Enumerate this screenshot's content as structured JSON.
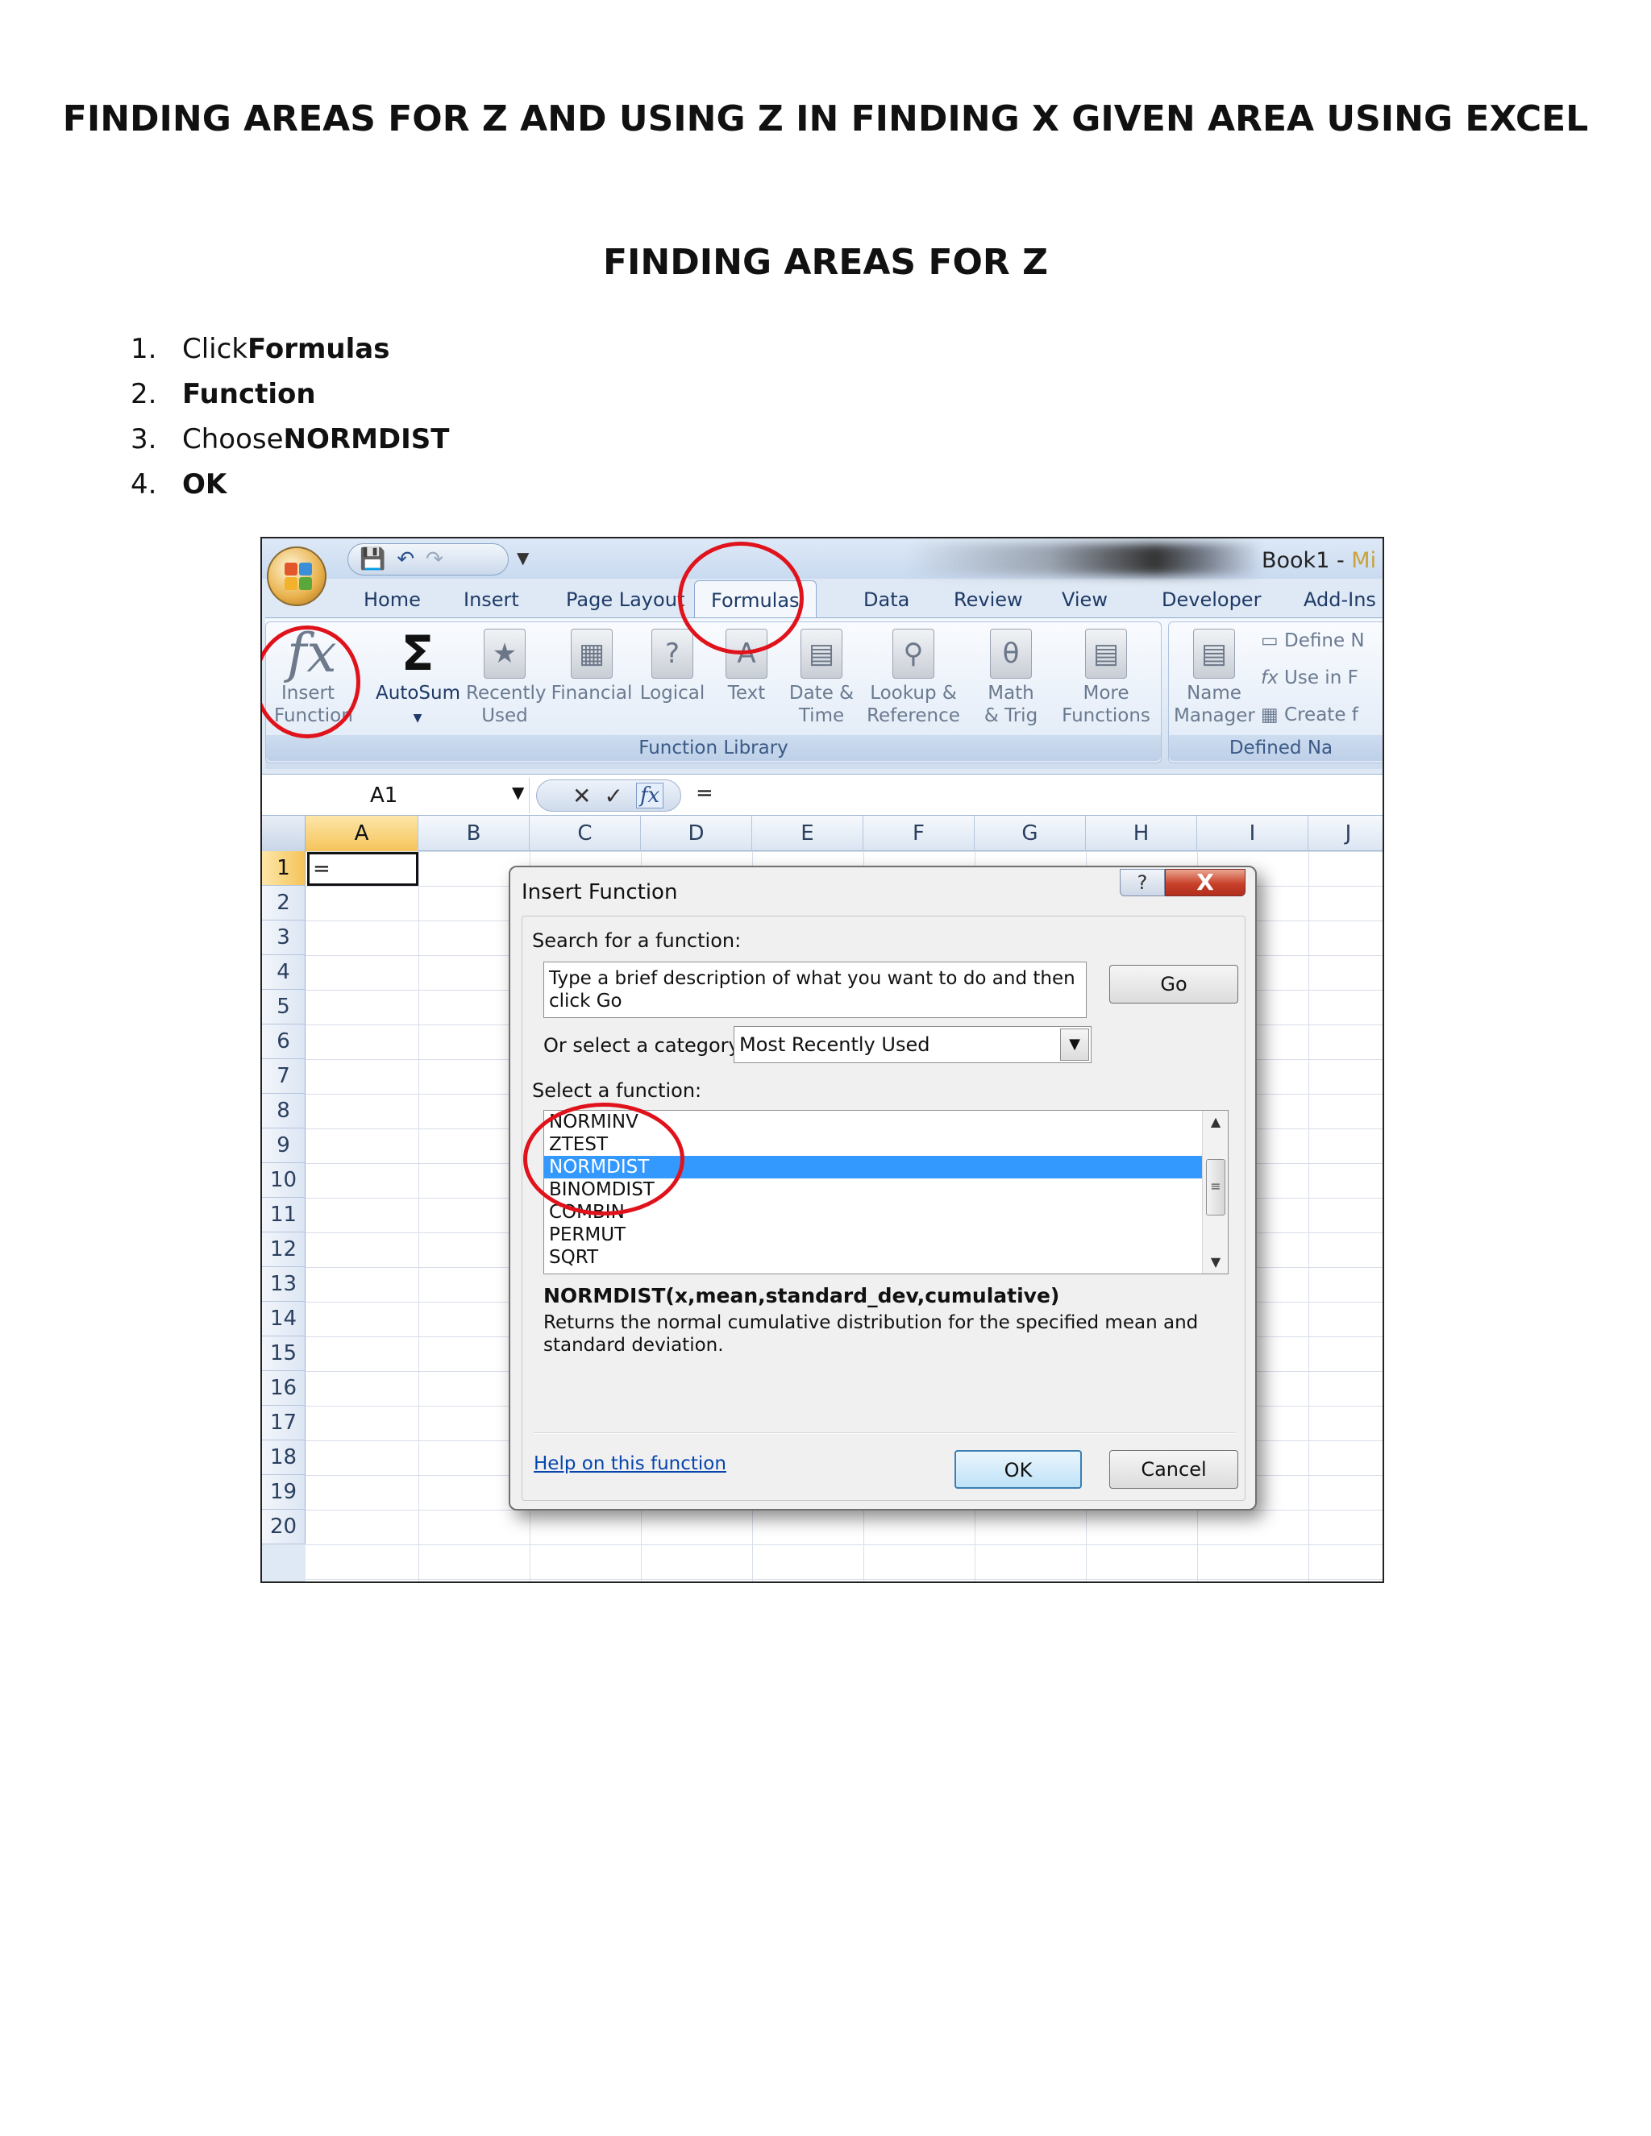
{
  "document": {
    "title": "FINDING AREAS FOR Z AND USING Z IN FINDING X GIVEN AREA USING EXCEL",
    "section_title": "FINDING AREAS FOR Z",
    "steps": [
      {
        "num": "1.",
        "prefix": "Click ",
        "bold": "Formulas"
      },
      {
        "num": "2.",
        "prefix": "",
        "bold": "Function"
      },
      {
        "num": "3.",
        "prefix": "Choose ",
        "bold": "NORMDIST"
      },
      {
        "num": "4.",
        "prefix": "",
        "bold": "OK"
      }
    ]
  },
  "excel": {
    "window_title": "Book1 - ",
    "window_title_suffix": "Mi",
    "tabs": [
      "Home",
      "Insert",
      "Page Layout",
      "Formulas",
      "Data",
      "Review",
      "View",
      "Developer",
      "Add-Ins"
    ],
    "active_tab": "Formulas",
    "ribbon": {
      "insert_function": {
        "line1": "Insert",
        "line2": "Function"
      },
      "autosum": "AutoSum",
      "recently_used": {
        "line1": "Recently",
        "line2": "Used"
      },
      "financial": "Financial",
      "logical": "Logical",
      "text": "Text",
      "date_time": {
        "line1": "Date &",
        "line2": "Time"
      },
      "lookup_reference": {
        "line1": "Lookup &",
        "line2": "Reference"
      },
      "math_trig": {
        "line1": "Math",
        "line2": "& Trig"
      },
      "more_functions": {
        "line1": "More",
        "line2": "Functions"
      },
      "function_library_label": "Function Library",
      "name_manager": {
        "line1": "Name",
        "line2": "Manager"
      },
      "define_name": "Define N",
      "use_in_formula": "Use in F",
      "create_from_selection": "Create f",
      "defined_names_label": "Defined Na"
    },
    "name_box": "A1",
    "formula_bar_content": "=",
    "columns": [
      "A",
      "B",
      "C",
      "D",
      "E",
      "F",
      "G",
      "H",
      "I",
      "J"
    ],
    "rows": [
      "1",
      "2",
      "3",
      "4",
      "5",
      "6",
      "7",
      "8",
      "9",
      "10",
      "11",
      "12",
      "13",
      "14",
      "15",
      "16",
      "17",
      "18",
      "19",
      "20"
    ],
    "cell_a1": "="
  },
  "dialog": {
    "title": "Insert Function",
    "help_glyph": "?",
    "close_glyph": "X",
    "search_label": "Search for a function:",
    "search_text": "Type a brief description of what you want to do and then click Go",
    "go_button": "Go",
    "category_label": "Or select a category:",
    "category_value": "Most Recently Used",
    "select_label": "Select a function:",
    "functions": [
      "NORMINV",
      "ZTEST",
      "NORMDIST",
      "BINOMDIST",
      "COMBIN",
      "PERMUT",
      "SQRT"
    ],
    "selected_function": "NORMDIST",
    "syntax": "NORMDIST(x,mean,standard_dev,cumulative)",
    "description": "Returns the normal cumulative distribution for the specified mean and standard deviation.",
    "help_link": "Help on this function",
    "ok_button": "OK",
    "cancel_button": "Cancel"
  },
  "colors": {
    "annotation_circle": "#e0121b",
    "selection": "#3399ff",
    "active_cell_header": "#f5c45a"
  }
}
